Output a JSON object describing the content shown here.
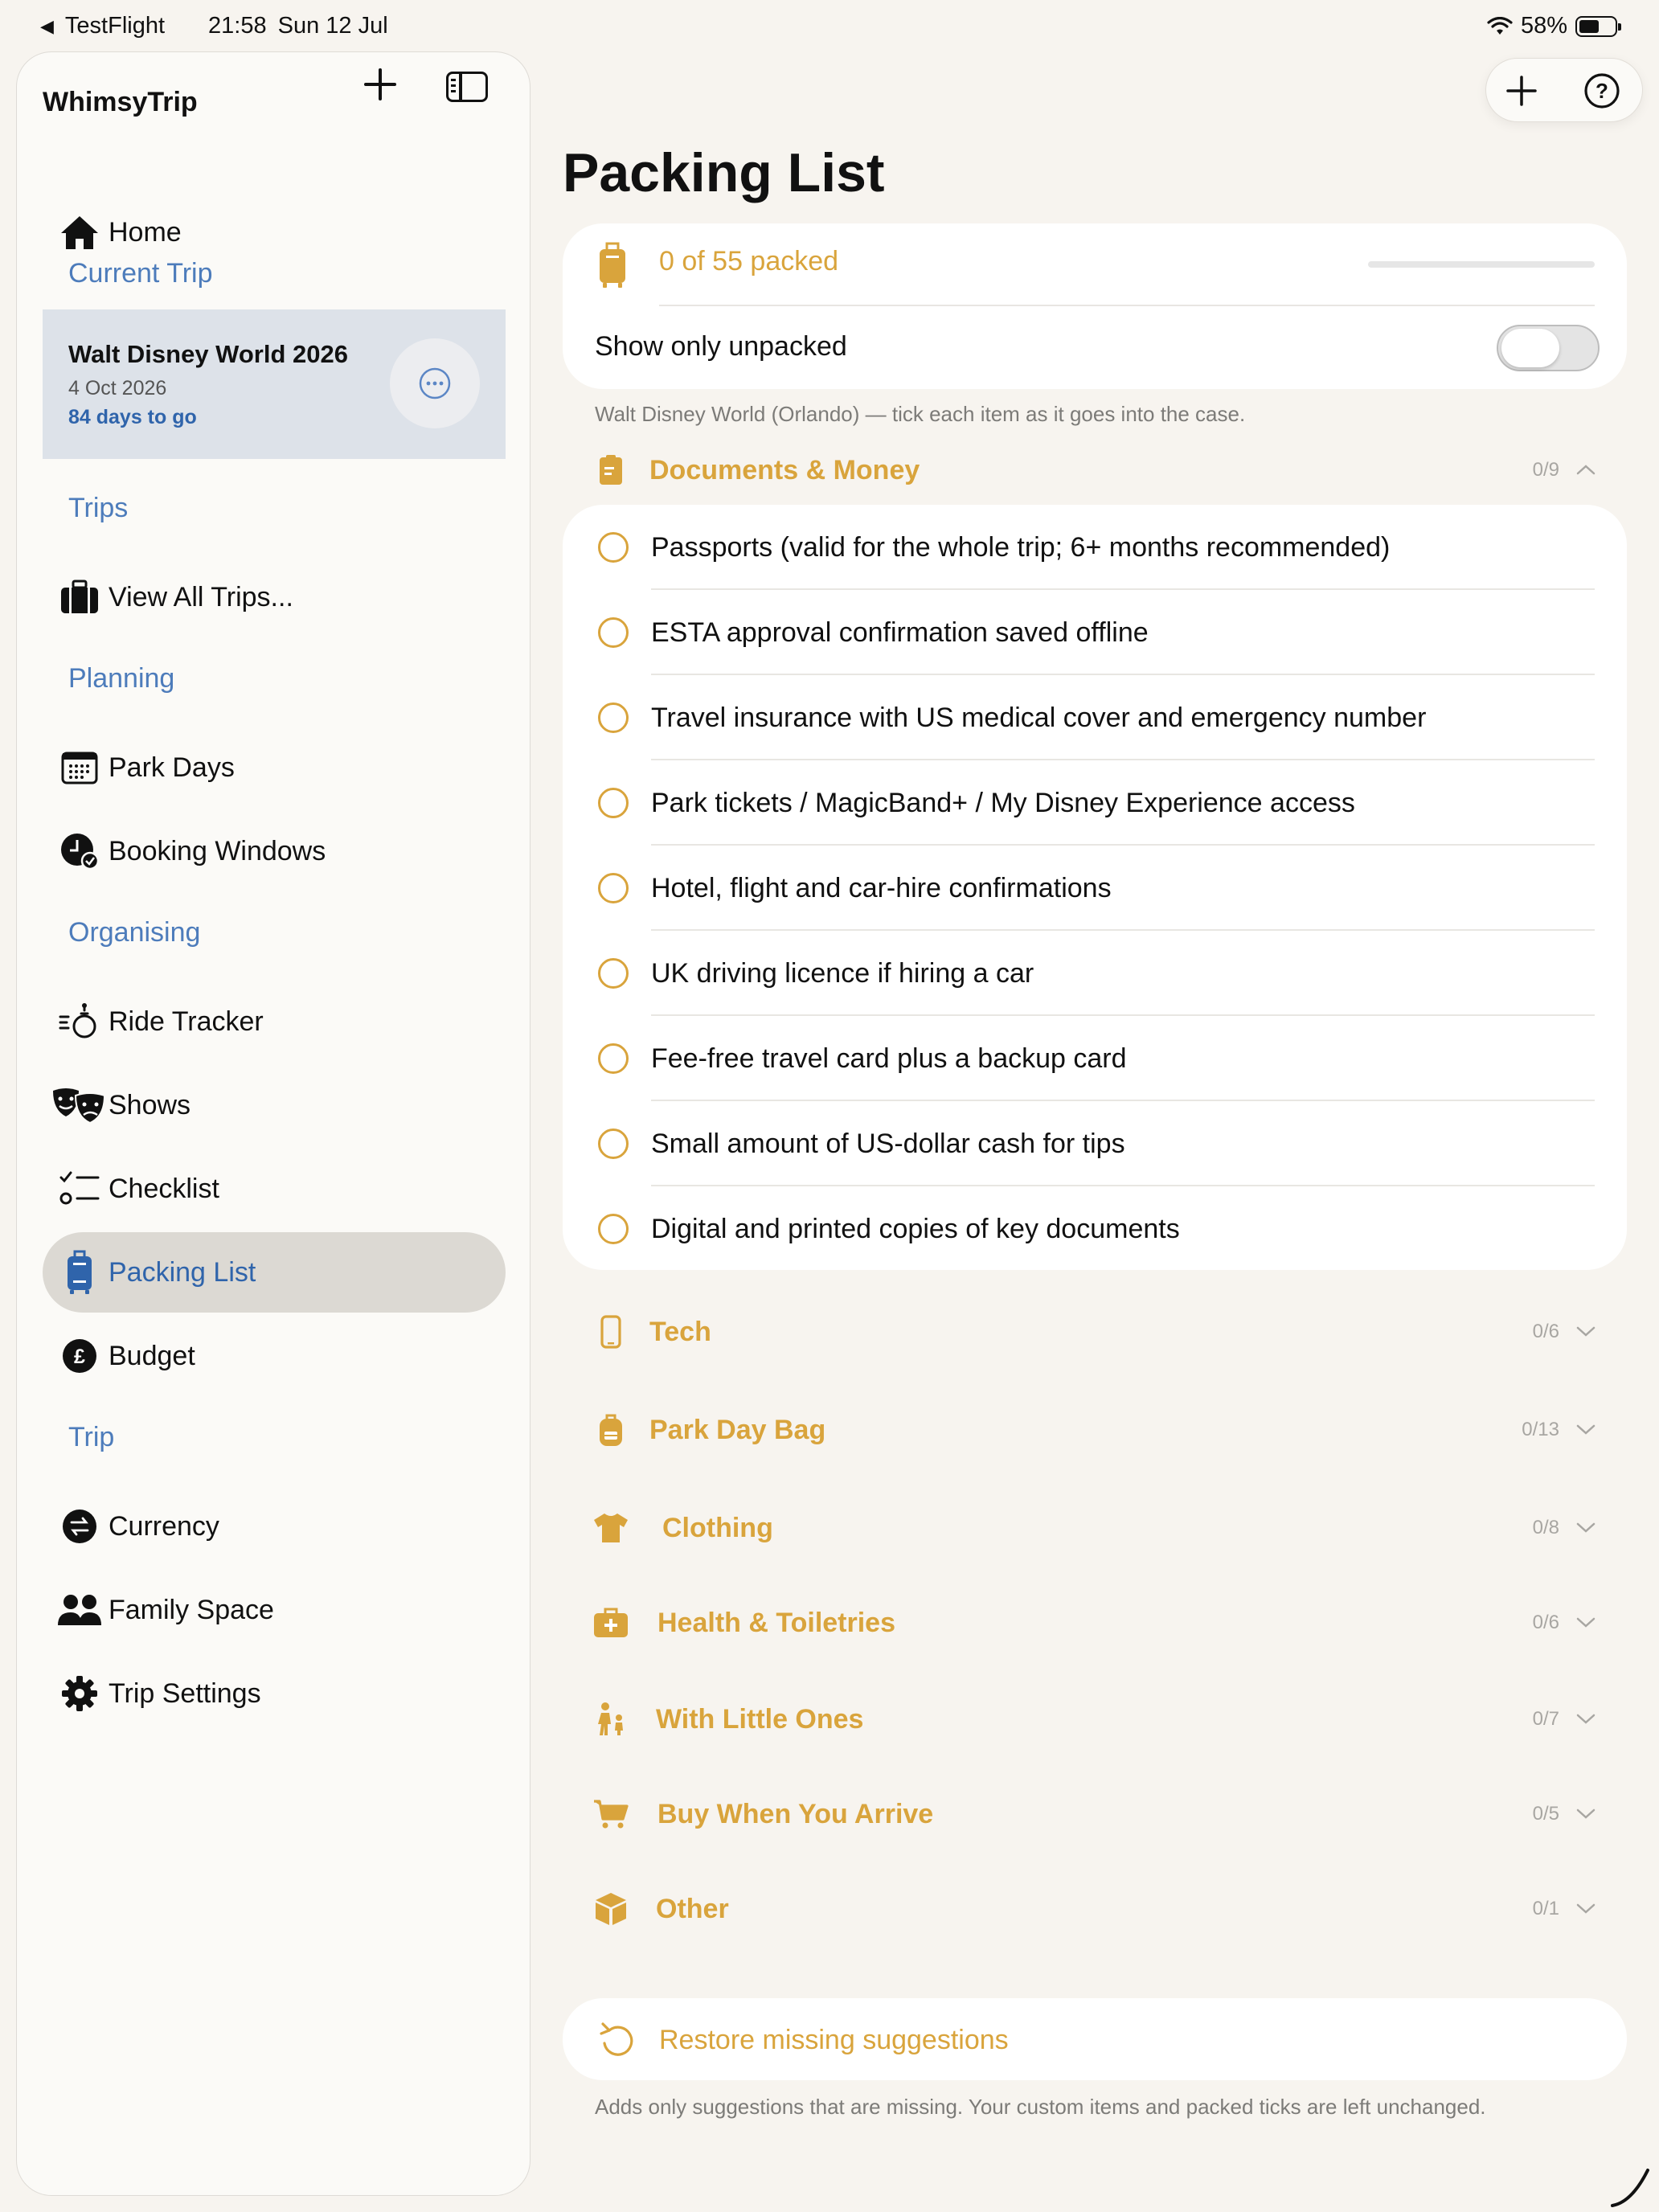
{
  "status_bar": {
    "back_app": "TestFlight",
    "time": "21:58",
    "date": "Sun 12 Jul",
    "battery": "58%"
  },
  "sidebar": {
    "app_title": "WhimsyTrip",
    "home_label": "Home",
    "current_trip_header": "Current Trip",
    "current_trip": {
      "name": "Walt Disney World 2026",
      "date": "4 Oct 2026",
      "countdown": "84 days to go"
    },
    "trips_header": "Trips",
    "view_all_trips": "View All Trips...",
    "planning_header": "Planning",
    "park_days": "Park Days",
    "booking_windows": "Booking Windows",
    "organising_header": "Organising",
    "ride_tracker": "Ride Tracker",
    "shows": "Shows",
    "checklist": "Checklist",
    "packing_list": "Packing List",
    "budget": "Budget",
    "trip_header": "Trip",
    "currency": "Currency",
    "family_space": "Family Space",
    "trip_settings": "Trip Settings"
  },
  "main": {
    "title": "Packing List",
    "packed_status": "0 of 55 packed",
    "packed_progress": 0,
    "show_only_unpacked_label": "Show only unpacked",
    "show_only_unpacked_on": false,
    "caption": "Walt Disney World (Orlando) — tick each item as it goes into the case.",
    "documents_money": {
      "name": "Documents & Money",
      "count": "0/9",
      "expanded": true,
      "items": [
        "Passports (valid for the whole trip; 6+ months recommended)",
        "ESTA approval confirmation saved offline",
        "Travel insurance with US medical cover and emergency number",
        "Park tickets / MagicBand+ / My Disney Experience access",
        "Hotel, flight and car-hire confirmations",
        "UK driving licence if hiring a car",
        "Fee-free travel card plus a backup card",
        "Small amount of US-dollar cash for tips",
        "Digital and printed copies of key documents"
      ]
    },
    "categories": [
      {
        "name": "Tech",
        "count": "0/6",
        "icon": "phone-icon"
      },
      {
        "name": "Park Day Bag",
        "count": "0/13",
        "icon": "backpack-icon"
      },
      {
        "name": "Clothing",
        "count": "0/8",
        "icon": "tshirt-icon"
      },
      {
        "name": "Health & Toiletries",
        "count": "0/6",
        "icon": "first-aid-icon"
      },
      {
        "name": "With Little Ones",
        "count": "0/7",
        "icon": "family-icon"
      },
      {
        "name": "Buy When You Arrive",
        "count": "0/5",
        "icon": "cart-icon"
      },
      {
        "name": "Other",
        "count": "0/1",
        "icon": "box-icon"
      }
    ],
    "restore_label": "Restore missing suggestions",
    "restore_caption": "Adds only suggestions that are missing. Your custom items and packed ticks are left unchanged."
  },
  "colors": {
    "accent_gold": "#d9a43c",
    "sidebar_blue": "#4d7cbb",
    "active_blue": "#2f64ab"
  }
}
